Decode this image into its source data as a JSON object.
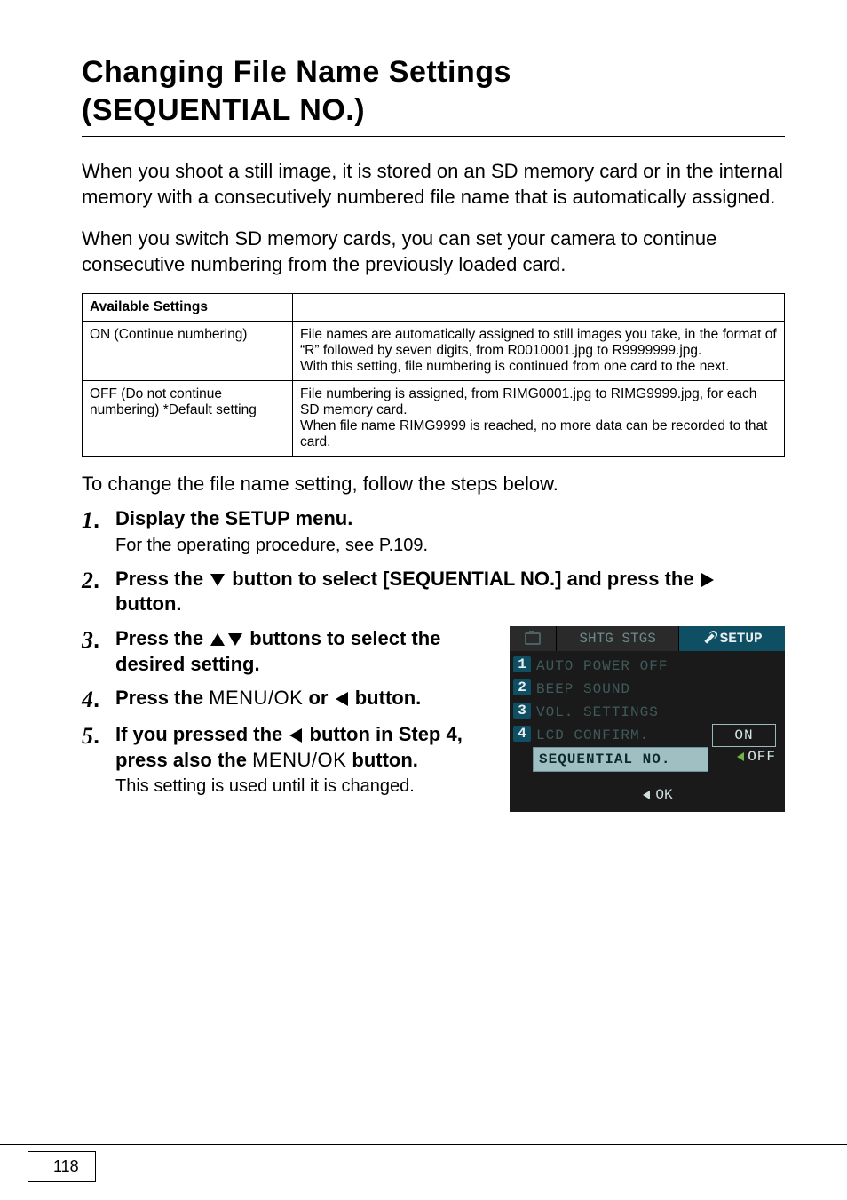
{
  "title_line1": "Changing File Name Settings",
  "title_line2": "(SEQUENTIAL NO.)",
  "intro_p1": "When you shoot a still image, it is stored on an SD memory card or in the internal memory with a consecutively numbered file name that is automatically assigned.",
  "intro_p2": "When you switch SD memory cards, you can set your camera to continue consecutive numbering from the previously loaded card.",
  "table": {
    "header_label": "Available Settings",
    "rows": [
      {
        "name": "ON (Continue numbering)",
        "desc": "File names are automatically assigned to still images you take, in the format of “R” followed by seven digits, from R0010001.jpg to R9999999.jpg.\nWith this setting, file numbering is continued from one card to the next."
      },
      {
        "name": "OFF (Do not continue numbering) *Default setting",
        "desc": "File numbering is assigned, from RIMG0001.jpg to RIMG9999.jpg, for each SD memory card.\nWhen file name RIMG9999 is reached, no more data can be recorded to that card."
      }
    ]
  },
  "after_table": "To change the file name setting, follow the steps below.",
  "steps": {
    "s1_title": "Display the SETUP menu.",
    "s1_sub": "For the operating procedure, see P.109.",
    "s2_a": "Press the ",
    "s2_b": " button to select [SEQUENTIAL NO.] and press the ",
    "s2_c": " button.",
    "s3_a": "Press the ",
    "s3_b": " buttons to select the desired setting.",
    "s4_a": "Press the ",
    "s4_menu": "MENU/OK",
    "s4_b": " or ",
    "s4_c": " button.",
    "s5_a": "If you pressed the ",
    "s5_b": " button in Step 4, press also the ",
    "s5_menu": "MENU/OK",
    "s5_c": " button.",
    "s5_sub": "This setting is used until it is changed."
  },
  "lcd": {
    "tab_mid": "SHTG STGS",
    "tab_right": "SETUP",
    "items": [
      "AUTO POWER OFF",
      "BEEP SOUND",
      "VOL. SETTINGS",
      "LCD CONFIRM."
    ],
    "on": "ON",
    "highlight": "SEQUENTIAL NO.",
    "off": "OFF",
    "ok": "OK"
  },
  "page_number": "118"
}
